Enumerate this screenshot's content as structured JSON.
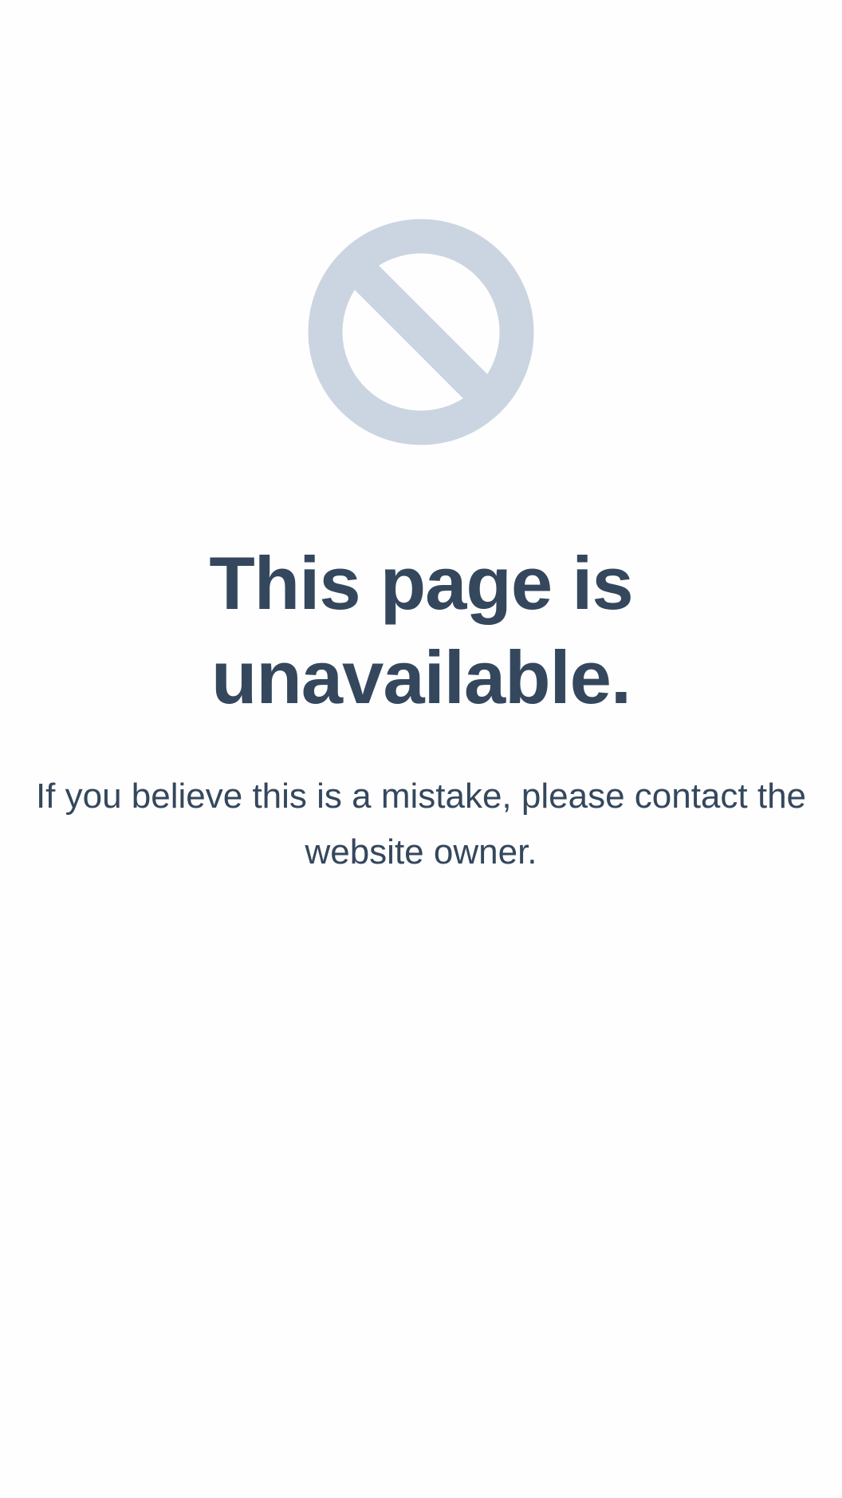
{
  "colors": {
    "background": "#fefefe",
    "text": "#34475d",
    "icon": "#cbd5e1"
  },
  "icon": {
    "name": "blocked-icon"
  },
  "heading": {
    "text": "This page is unavailable."
  },
  "message": {
    "text": "If you believe this is a mistake, please contact the website owner."
  }
}
